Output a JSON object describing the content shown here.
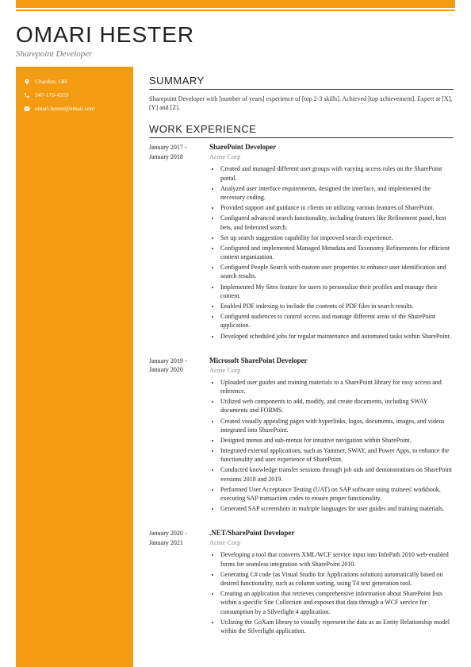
{
  "name": "OMARI HESTER",
  "title": "Sharepoint Developer",
  "contact": {
    "location": "Chardon, OH",
    "phone": "347-170-4359",
    "email": "omari.hester@email.com"
  },
  "sections": {
    "summary": {
      "heading": "SUMMARY",
      "text": "Sharepoint Developer with [number of years] experience of [top 2-3 skills]. Achieved [top achievement]. Expert at [X], [Y] and [Z]."
    },
    "work": {
      "heading": "WORK EXPERIENCE",
      "jobs": [
        {
          "date": "January 2017 - January 2018",
          "title": "SharePoint Developer",
          "company": "Acme Corp",
          "bullets": [
            "Created and managed different user groups with varying access roles on the SharePoint portal.",
            "Analyzed user interface requirements, designed the interface, and implemented the necessary coding.",
            "Provided support and guidance to clients on utilizing various features of SharePoint.",
            "Configured advanced search functionality, including features like Refinement panel, best bets, and federated search.",
            "Set up search suggestion capability for improved search experience.",
            "Configured and implemented Managed Metadata and Taxonomy Refinements for efficient content organization.",
            "Configured People Search with custom user properties to enhance user identification and search results.",
            "Implemented My Sites feature for users to personalize their profiles and manage their content.",
            "Enabled PDF indexing to include the contents of PDF files in search results.",
            "Configured audiences to control access and manage different areas of the SharePoint application.",
            "Developed scheduled jobs for regular maintenance and automated tasks within SharePoint."
          ]
        },
        {
          "date": "January 2019 - January 2020",
          "title": "Microsoft SharePoint Developer",
          "company": "Acme Corp",
          "bullets": [
            "Uploaded user guides and training materials to a SharePoint library for easy access and reference.",
            "Utilized web components to add, modify, and create documents, including SWAY documents and FORMS.",
            "Created visually appealing pages with hyperlinks, logos, documents, images, and videos integrated into SharePoint.",
            "Designed menus and sub-menus for intuitive navigation within SharePoint.",
            "Integrated external applications, such as Yammer, SWAY, and Power Apps, to enhance the functionality and user experience of SharePoint.",
            "Conducted knowledge transfer sessions through job aids and demonstrations on SharePoint versions 2018 and 2019.",
            "Performed User Acceptance Testing (UAT) on SAP software using trainees' workbook, executing SAP transaction codes to ensure proper functionality.",
            "Generated SAP screenshots in multiple languages for user guides and training materials."
          ]
        },
        {
          "date": "January 2020 - January 2021",
          "title": ".NET/SharePoint Developer",
          "company": "Acme Corp",
          "bullets": [
            "Developing a tool that converts XML/WCF service input into InfoPath 2010 web-enabled forms for seamless integration with SharePoint 2010.",
            "Generating C# code (as Visual Studio for Applications solution) automatically based on desired functionality, such as column sorting, using T4 text generation tool.",
            "Creating an application that retrieves comprehensive information about SharePoint lists within a specific Site Collection and exposes that data through a WCF service for consumption by a Silverlight 4 application.",
            "Utilizing the GoXam library to visually represent the data as an Entity Relationship model within the Silverlight application."
          ]
        }
      ]
    }
  }
}
